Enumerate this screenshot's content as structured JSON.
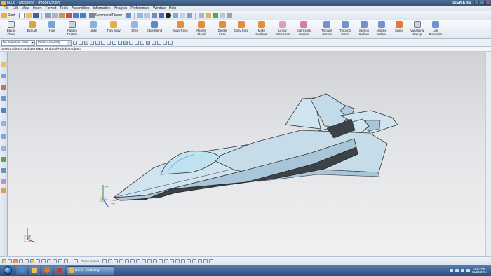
{
  "titlebar": {
    "title": "NX 8 - Modeling - [model29.prt]",
    "brand": "SIEMENS"
  },
  "menubar": {
    "items": [
      "File",
      "Edit",
      "View",
      "Insert",
      "Format",
      "Tools",
      "Assemblies",
      "Information",
      "Analysis",
      "Preferences",
      "Window",
      "Help"
    ]
  },
  "quickbar": {
    "start_label": "Start",
    "command_finder": "Command Finder"
  },
  "ribbon": {
    "buttons": [
      [
        "Datum",
        "Plane"
      ],
      [
        "Extrude",
        ""
      ],
      [
        "Hole",
        ""
      ],
      [
        "Pattern",
        "Feature"
      ],
      [
        "Unite",
        ""
      ],
      [
        "Trim Body",
        ""
      ],
      [
        "Shell",
        ""
      ],
      [
        "Edge Blend",
        ""
      ],
      [
        "Move Face",
        ""
      ],
      [
        "Resize",
        "Blend"
      ],
      [
        "Delete",
        "Face"
      ],
      [
        "Copy Face",
        ""
      ],
      [
        "Make",
        "Coplanar"
      ],
      [
        "Linear",
        "Dimension"
      ],
      [
        "Edit Cross",
        "Section"
      ],
      [
        "Through",
        "Curves"
      ],
      [
        "Through",
        "Curve"
      ],
      [
        "Section",
        "Surface"
      ],
      [
        "N-sided",
        "Surface"
      ],
      [
        "Swept",
        ""
      ],
      [
        "Variational",
        "Sweep"
      ],
      [
        "Law",
        "Extension"
      ]
    ]
  },
  "selection": {
    "filter": "No Selection Filter",
    "scope": "Entire Assembly"
  },
  "cue_line": "Select objects and use MB3, or double-click an object",
  "bottombar": {
    "label": "Trace Statist"
  },
  "taskbar": {
    "task_label": "NX 8 - Modeling",
    "time": "4:27 PM",
    "date": "11/26/2014"
  },
  "colors": {
    "aircraft_top": "#cfe4ef",
    "aircraft_side": "#a9c6d8",
    "aircraft_belly": "#3d4247",
    "canopy": "#bfe2f0"
  },
  "icons": [
    "start-orb-icon",
    "ie-icon",
    "explorer-icon",
    "media-player-icon",
    "nx-icon",
    "wcs-triad-icon",
    "absolute-triad-icon"
  ]
}
